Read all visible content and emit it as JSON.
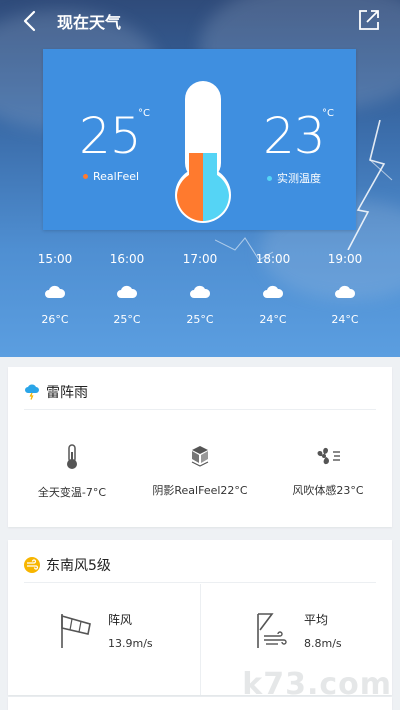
{
  "header": {
    "title": "现在天气"
  },
  "temperature_card": {
    "realfeel_value": "25",
    "realfeel_unit": "°C",
    "realfeel_label": "RealFeel",
    "measured_value": "23",
    "measured_unit": "°C",
    "measured_label": "实测温度",
    "colors": {
      "realfeel": "#ff7a2e",
      "measured": "#55d4f5"
    }
  },
  "hourly": [
    {
      "time": "15:00",
      "icon": "cloud-icon",
      "temp": "26°C"
    },
    {
      "time": "16:00",
      "icon": "cloud-icon",
      "temp": "25°C"
    },
    {
      "time": "17:00",
      "icon": "cloud-icon",
      "temp": "25°C"
    },
    {
      "time": "18:00",
      "icon": "cloud-icon",
      "temp": "24°C"
    },
    {
      "time": "19:00",
      "icon": "cloud-icon",
      "temp": "24°C"
    }
  ],
  "condition_card": {
    "title": "雷阵雨",
    "stats": [
      {
        "icon": "thermometer-icon",
        "label": "全天变温-7°C"
      },
      {
        "icon": "shade-cube-icon",
        "label": "阴影RealFeel22°C"
      },
      {
        "icon": "fan-icon",
        "label": "风吹体感23°C"
      }
    ]
  },
  "wind_card": {
    "title": "东南风5级",
    "gust_label": "阵风",
    "gust_value": "13.9m/s",
    "avg_label": "平均",
    "avg_value": "8.8m/s"
  },
  "watermark": "k73.com"
}
